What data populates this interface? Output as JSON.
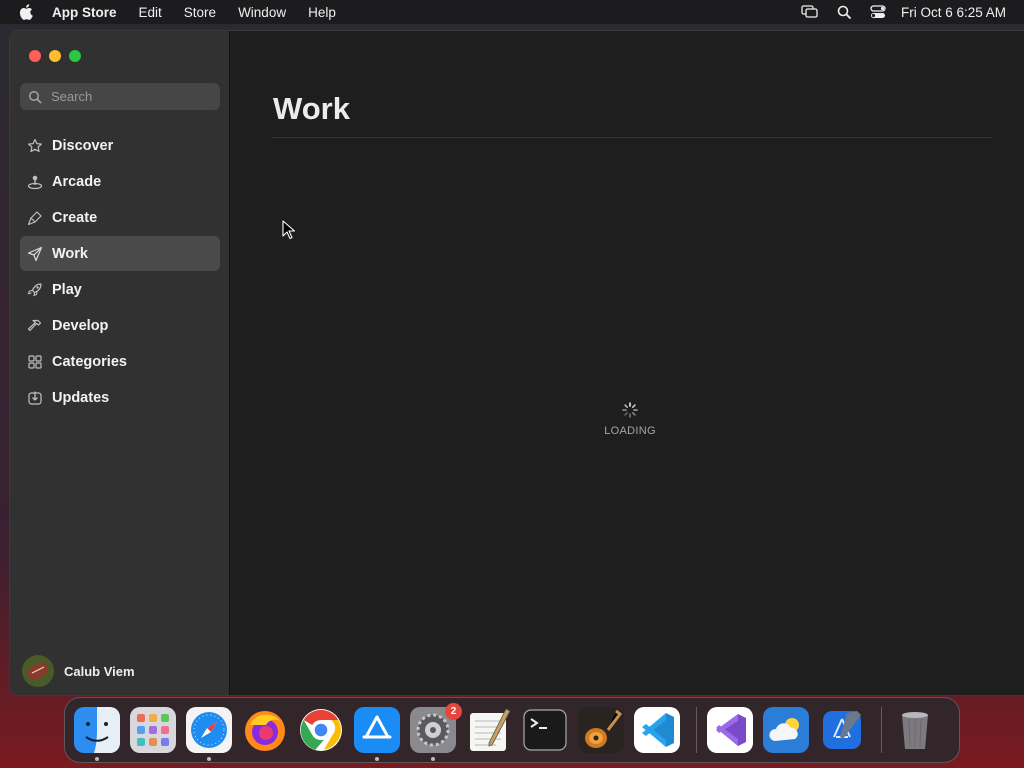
{
  "menubar": {
    "app_name": "App Store",
    "items": [
      "Edit",
      "Store",
      "Window",
      "Help"
    ],
    "clock": "Fri Oct 6  6:25 AM"
  },
  "search": {
    "placeholder": "Search"
  },
  "sidebar": {
    "items": [
      {
        "label": "Discover",
        "icon": "star-icon"
      },
      {
        "label": "Arcade",
        "icon": "joystick-icon"
      },
      {
        "label": "Create",
        "icon": "brush-icon"
      },
      {
        "label": "Work",
        "icon": "paper-plane-icon",
        "active": true
      },
      {
        "label": "Play",
        "icon": "rocket-icon"
      },
      {
        "label": "Develop",
        "icon": "hammer-icon"
      },
      {
        "label": "Categories",
        "icon": "grid-icon"
      },
      {
        "label": "Updates",
        "icon": "download-icon"
      }
    ],
    "user_name": "Calub Viem"
  },
  "main": {
    "title": "Work",
    "loading_text": "LOADING"
  },
  "dock": {
    "apps": [
      {
        "name": "Finder",
        "icon": "finder-icon",
        "running": true
      },
      {
        "name": "Launchpad",
        "icon": "launchpad-icon"
      },
      {
        "name": "Safari",
        "icon": "safari-icon",
        "running": true
      },
      {
        "name": "Firefox",
        "icon": "firefox-icon"
      },
      {
        "name": "Chrome",
        "icon": "chrome-icon"
      },
      {
        "name": "App Store",
        "icon": "app-store-icon",
        "running": true
      },
      {
        "name": "System Settings",
        "icon": "settings-icon",
        "running": true,
        "badge": "2"
      },
      {
        "name": "TextEdit",
        "icon": "textedit-icon"
      },
      {
        "name": "Terminal",
        "icon": "terminal-icon"
      },
      {
        "name": "GarageBand",
        "icon": "garageband-icon"
      },
      {
        "name": "Visual Studio Code",
        "icon": "vscode-icon"
      },
      {
        "name": "Visual Studio",
        "icon": "visual-studio-icon"
      },
      {
        "name": "Weather",
        "icon": "weather-icon"
      },
      {
        "name": "Xcode",
        "icon": "xcode-icon"
      },
      {
        "name": "Trash",
        "icon": "trash-icon"
      }
    ]
  },
  "colors": {
    "accent_red": "#fe5f57",
    "accent_yellow": "#febc2e",
    "accent_green": "#28c840",
    "badge_red": "#e8453c"
  }
}
